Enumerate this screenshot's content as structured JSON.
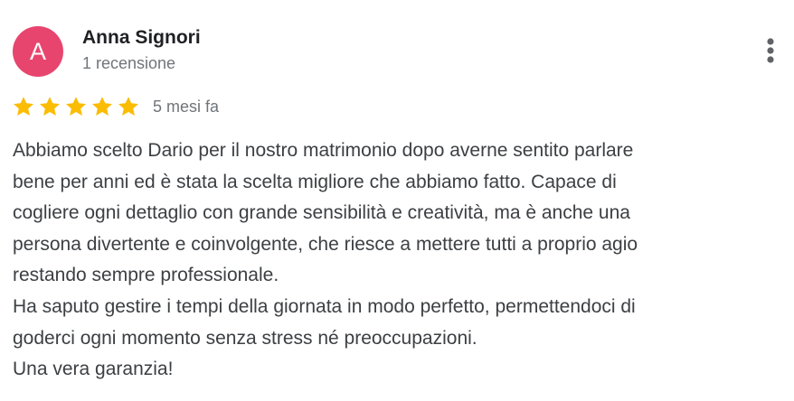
{
  "review": {
    "avatar": {
      "initial": "A",
      "color": "#e8456e"
    },
    "author_name": "Anna Signori",
    "review_count": "1 recensione",
    "rating": 5,
    "rating_max": 5,
    "star_color": "#fbbc04",
    "date": "5 mesi fa",
    "menu_icon": "more-vert-icon",
    "text": "Abbiamo scelto Dario per il nostro matrimonio dopo averne sentito parlare\nbene per anni ed è stata la scelta migliore che abbiamo fatto. Capace di\ncogliere ogni dettaglio con grande sensibilità e creatività, ma è anche una\npersona divertente e coinvolgente, che riesce a mettere tutti a proprio agio\nrestando sempre professionale.\nHa saputo gestire i tempi della giornata in modo perfetto, permettendoci di\ngoderci ogni momento senza stress né preoccupazioni.\nUna vera garanzia!"
  }
}
